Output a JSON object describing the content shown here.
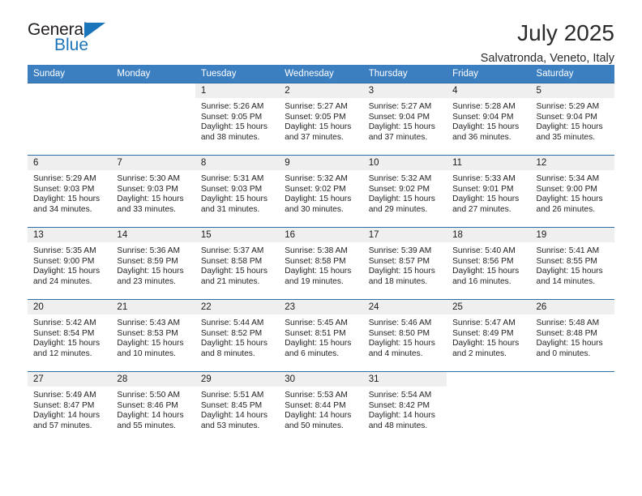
{
  "brand": {
    "name_part1": "General",
    "name_part2": "Blue",
    "accent_color": "#1b75bb"
  },
  "header": {
    "month_title": "July 2025",
    "location": "Salvatronda, Veneto, Italy"
  },
  "theme": {
    "header_blue": "#3c7fc1",
    "row_rule_blue": "#2e6da4",
    "daynum_background": "#efefef"
  },
  "weekday_headers": [
    "Sunday",
    "Monday",
    "Tuesday",
    "Wednesday",
    "Thursday",
    "Friday",
    "Saturday"
  ],
  "weeks": [
    [
      {
        "day": "",
        "sunrise": "",
        "sunset": "",
        "daylight_line1": "",
        "daylight_line2": "",
        "empty": true
      },
      {
        "day": "",
        "sunrise": "",
        "sunset": "",
        "daylight_line1": "",
        "daylight_line2": "",
        "empty": true
      },
      {
        "day": "1",
        "sunrise": "Sunrise: 5:26 AM",
        "sunset": "Sunset: 9:05 PM",
        "daylight_line1": "Daylight: 15 hours",
        "daylight_line2": "and 38 minutes."
      },
      {
        "day": "2",
        "sunrise": "Sunrise: 5:27 AM",
        "sunset": "Sunset: 9:05 PM",
        "daylight_line1": "Daylight: 15 hours",
        "daylight_line2": "and 37 minutes."
      },
      {
        "day": "3",
        "sunrise": "Sunrise: 5:27 AM",
        "sunset": "Sunset: 9:04 PM",
        "daylight_line1": "Daylight: 15 hours",
        "daylight_line2": "and 37 minutes."
      },
      {
        "day": "4",
        "sunrise": "Sunrise: 5:28 AM",
        "sunset": "Sunset: 9:04 PM",
        "daylight_line1": "Daylight: 15 hours",
        "daylight_line2": "and 36 minutes."
      },
      {
        "day": "5",
        "sunrise": "Sunrise: 5:29 AM",
        "sunset": "Sunset: 9:04 PM",
        "daylight_line1": "Daylight: 15 hours",
        "daylight_line2": "and 35 minutes."
      }
    ],
    [
      {
        "day": "6",
        "sunrise": "Sunrise: 5:29 AM",
        "sunset": "Sunset: 9:03 PM",
        "daylight_line1": "Daylight: 15 hours",
        "daylight_line2": "and 34 minutes."
      },
      {
        "day": "7",
        "sunrise": "Sunrise: 5:30 AM",
        "sunset": "Sunset: 9:03 PM",
        "daylight_line1": "Daylight: 15 hours",
        "daylight_line2": "and 33 minutes."
      },
      {
        "day": "8",
        "sunrise": "Sunrise: 5:31 AM",
        "sunset": "Sunset: 9:03 PM",
        "daylight_line1": "Daylight: 15 hours",
        "daylight_line2": "and 31 minutes."
      },
      {
        "day": "9",
        "sunrise": "Sunrise: 5:32 AM",
        "sunset": "Sunset: 9:02 PM",
        "daylight_line1": "Daylight: 15 hours",
        "daylight_line2": "and 30 minutes."
      },
      {
        "day": "10",
        "sunrise": "Sunrise: 5:32 AM",
        "sunset": "Sunset: 9:02 PM",
        "daylight_line1": "Daylight: 15 hours",
        "daylight_line2": "and 29 minutes."
      },
      {
        "day": "11",
        "sunrise": "Sunrise: 5:33 AM",
        "sunset": "Sunset: 9:01 PM",
        "daylight_line1": "Daylight: 15 hours",
        "daylight_line2": "and 27 minutes."
      },
      {
        "day": "12",
        "sunrise": "Sunrise: 5:34 AM",
        "sunset": "Sunset: 9:00 PM",
        "daylight_line1": "Daylight: 15 hours",
        "daylight_line2": "and 26 minutes."
      }
    ],
    [
      {
        "day": "13",
        "sunrise": "Sunrise: 5:35 AM",
        "sunset": "Sunset: 9:00 PM",
        "daylight_line1": "Daylight: 15 hours",
        "daylight_line2": "and 24 minutes."
      },
      {
        "day": "14",
        "sunrise": "Sunrise: 5:36 AM",
        "sunset": "Sunset: 8:59 PM",
        "daylight_line1": "Daylight: 15 hours",
        "daylight_line2": "and 23 minutes."
      },
      {
        "day": "15",
        "sunrise": "Sunrise: 5:37 AM",
        "sunset": "Sunset: 8:58 PM",
        "daylight_line1": "Daylight: 15 hours",
        "daylight_line2": "and 21 minutes."
      },
      {
        "day": "16",
        "sunrise": "Sunrise: 5:38 AM",
        "sunset": "Sunset: 8:58 PM",
        "daylight_line1": "Daylight: 15 hours",
        "daylight_line2": "and 19 minutes."
      },
      {
        "day": "17",
        "sunrise": "Sunrise: 5:39 AM",
        "sunset": "Sunset: 8:57 PM",
        "daylight_line1": "Daylight: 15 hours",
        "daylight_line2": "and 18 minutes."
      },
      {
        "day": "18",
        "sunrise": "Sunrise: 5:40 AM",
        "sunset": "Sunset: 8:56 PM",
        "daylight_line1": "Daylight: 15 hours",
        "daylight_line2": "and 16 minutes."
      },
      {
        "day": "19",
        "sunrise": "Sunrise: 5:41 AM",
        "sunset": "Sunset: 8:55 PM",
        "daylight_line1": "Daylight: 15 hours",
        "daylight_line2": "and 14 minutes."
      }
    ],
    [
      {
        "day": "20",
        "sunrise": "Sunrise: 5:42 AM",
        "sunset": "Sunset: 8:54 PM",
        "daylight_line1": "Daylight: 15 hours",
        "daylight_line2": "and 12 minutes."
      },
      {
        "day": "21",
        "sunrise": "Sunrise: 5:43 AM",
        "sunset": "Sunset: 8:53 PM",
        "daylight_line1": "Daylight: 15 hours",
        "daylight_line2": "and 10 minutes."
      },
      {
        "day": "22",
        "sunrise": "Sunrise: 5:44 AM",
        "sunset": "Sunset: 8:52 PM",
        "daylight_line1": "Daylight: 15 hours",
        "daylight_line2": "and 8 minutes."
      },
      {
        "day": "23",
        "sunrise": "Sunrise: 5:45 AM",
        "sunset": "Sunset: 8:51 PM",
        "daylight_line1": "Daylight: 15 hours",
        "daylight_line2": "and 6 minutes."
      },
      {
        "day": "24",
        "sunrise": "Sunrise: 5:46 AM",
        "sunset": "Sunset: 8:50 PM",
        "daylight_line1": "Daylight: 15 hours",
        "daylight_line2": "and 4 minutes."
      },
      {
        "day": "25",
        "sunrise": "Sunrise: 5:47 AM",
        "sunset": "Sunset: 8:49 PM",
        "daylight_line1": "Daylight: 15 hours",
        "daylight_line2": "and 2 minutes."
      },
      {
        "day": "26",
        "sunrise": "Sunrise: 5:48 AM",
        "sunset": "Sunset: 8:48 PM",
        "daylight_line1": "Daylight: 15 hours",
        "daylight_line2": "and 0 minutes."
      }
    ],
    [
      {
        "day": "27",
        "sunrise": "Sunrise: 5:49 AM",
        "sunset": "Sunset: 8:47 PM",
        "daylight_line1": "Daylight: 14 hours",
        "daylight_line2": "and 57 minutes."
      },
      {
        "day": "28",
        "sunrise": "Sunrise: 5:50 AM",
        "sunset": "Sunset: 8:46 PM",
        "daylight_line1": "Daylight: 14 hours",
        "daylight_line2": "and 55 minutes."
      },
      {
        "day": "29",
        "sunrise": "Sunrise: 5:51 AM",
        "sunset": "Sunset: 8:45 PM",
        "daylight_line1": "Daylight: 14 hours",
        "daylight_line2": "and 53 minutes."
      },
      {
        "day": "30",
        "sunrise": "Sunrise: 5:53 AM",
        "sunset": "Sunset: 8:44 PM",
        "daylight_line1": "Daylight: 14 hours",
        "daylight_line2": "and 50 minutes."
      },
      {
        "day": "31",
        "sunrise": "Sunrise: 5:54 AM",
        "sunset": "Sunset: 8:42 PM",
        "daylight_line1": "Daylight: 14 hours",
        "daylight_line2": "and 48 minutes."
      },
      {
        "day": "",
        "sunrise": "",
        "sunset": "",
        "daylight_line1": "",
        "daylight_line2": "",
        "empty": true
      },
      {
        "day": "",
        "sunrise": "",
        "sunset": "",
        "daylight_line1": "",
        "daylight_line2": "",
        "empty": true
      }
    ]
  ]
}
